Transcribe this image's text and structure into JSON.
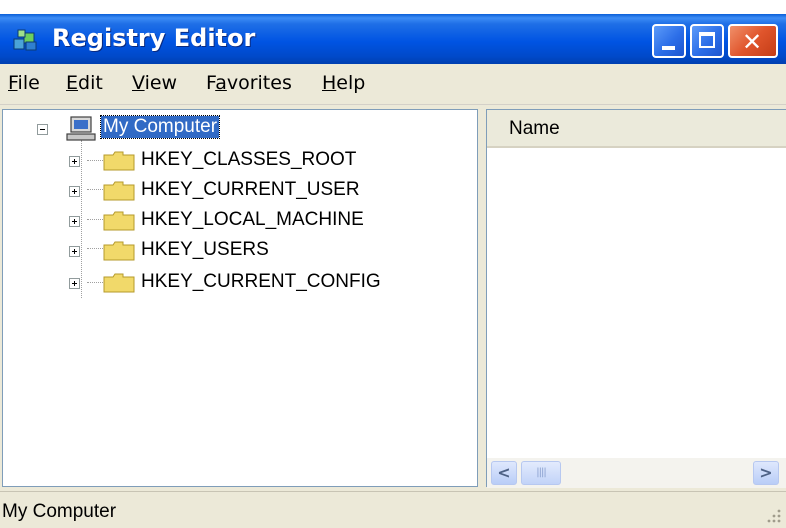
{
  "window": {
    "title": "Registry Editor",
    "title_bar_color": "#0054e3",
    "close_button_color": "#e0552c"
  },
  "menu": {
    "items": [
      {
        "label": "File",
        "accel": "F",
        "rest": "ile"
      },
      {
        "label": "Edit",
        "accel": "E",
        "rest": "dit"
      },
      {
        "label": "View",
        "accel": "V",
        "rest": "iew"
      },
      {
        "label": "Favorites",
        "accel": "a",
        "pre": "F",
        "rest": "vorites"
      },
      {
        "label": "Help",
        "accel": "H",
        "rest": "elp"
      }
    ]
  },
  "tree": {
    "root": {
      "label": "My Computer",
      "icon": "computer-icon",
      "expanded": true,
      "selected": true
    },
    "keys": [
      {
        "label": "HKEY_CLASSES_ROOT",
        "icon": "folder-icon"
      },
      {
        "label": "HKEY_CURRENT_USER",
        "icon": "folder-icon"
      },
      {
        "label": "HKEY_LOCAL_MACHINE",
        "icon": "folder-icon"
      },
      {
        "label": "HKEY_USERS",
        "icon": "folder-icon"
      },
      {
        "label": "HKEY_CURRENT_CONFIG",
        "icon": "folder-icon"
      }
    ]
  },
  "list": {
    "columns": [
      "Name"
    ]
  },
  "status": {
    "text": "My Computer"
  },
  "colors": {
    "selection": "#316ac5",
    "folder": "#f1d96a"
  }
}
